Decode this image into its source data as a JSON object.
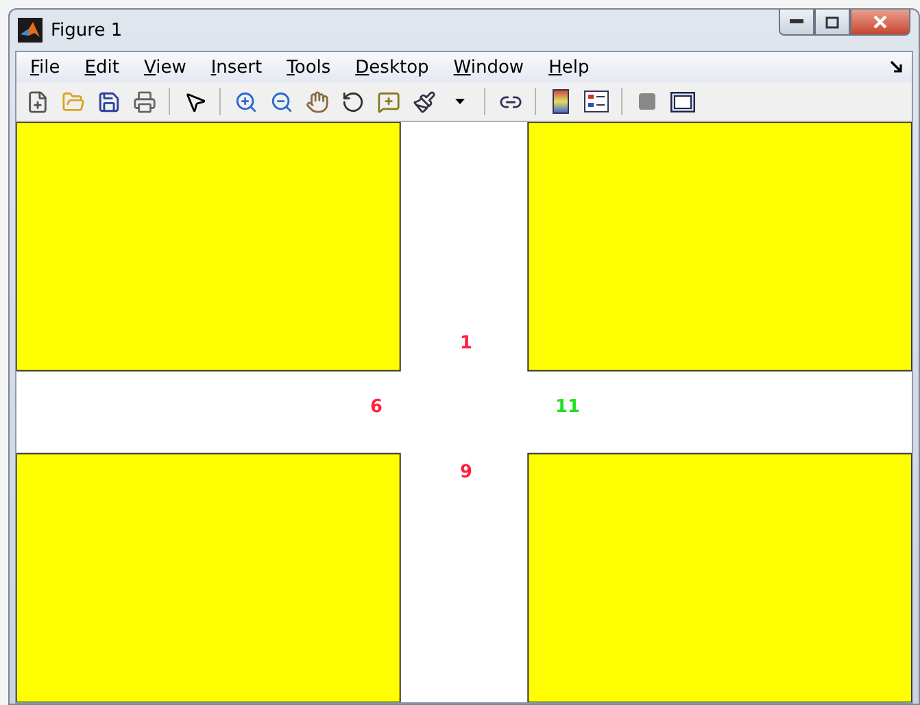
{
  "window": {
    "title": "Figure 1"
  },
  "menu": [
    "File",
    "Edit",
    "View",
    "Insert",
    "Tools",
    "Desktop",
    "Window",
    "Help"
  ],
  "plot": {
    "labels": [
      {
        "text": "1",
        "color": "#ff2040"
      },
      {
        "text": "6",
        "color": "#ff2040"
      },
      {
        "text": "11",
        "color": "#20e020"
      },
      {
        "text": "9",
        "color": "#ff2040"
      }
    ]
  }
}
